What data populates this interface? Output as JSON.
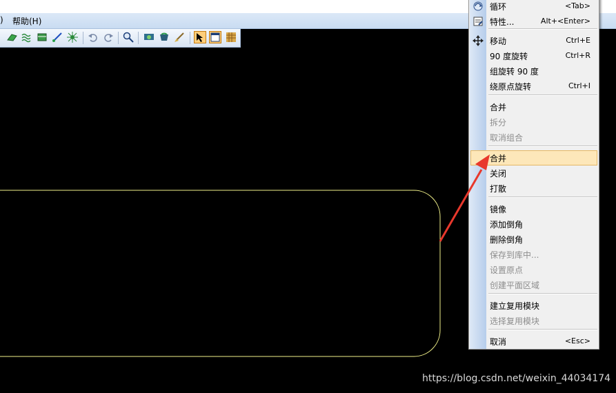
{
  "menubar": {
    "partial_label": ")",
    "help_label": "帮助(H)"
  },
  "context_menu": {
    "items": [
      {
        "label": "循环",
        "shortcut": "<Tab>",
        "icon": "cycle-icon",
        "disabled": false
      },
      {
        "label": "特性...",
        "shortcut": "Alt+<Enter>",
        "icon": "properties-icon",
        "disabled": false
      },
      {
        "label": "移动",
        "shortcut": "Ctrl+E",
        "icon": "move-icon",
        "disabled": false
      },
      {
        "label": "90 度旋转",
        "shortcut": "Ctrl+R",
        "disabled": false
      },
      {
        "label": "组旋转 90 度",
        "shortcut": "",
        "disabled": false
      },
      {
        "label": "绕原点旋转",
        "shortcut": "Ctrl+I",
        "disabled": false
      },
      {
        "label": "合并",
        "shortcut": "",
        "disabled": false
      },
      {
        "label": "拆分",
        "shortcut": "",
        "disabled": true
      },
      {
        "label": "取消组合",
        "shortcut": "",
        "disabled": true
      },
      {
        "label": "合并",
        "shortcut": "",
        "disabled": false,
        "highlighted": true
      },
      {
        "label": "关闭",
        "shortcut": "",
        "disabled": false
      },
      {
        "label": "打散",
        "shortcut": "",
        "disabled": false
      },
      {
        "label": "镜像",
        "shortcut": "",
        "disabled": false
      },
      {
        "label": "添加倒角",
        "shortcut": "",
        "disabled": false
      },
      {
        "label": "删除倒角",
        "shortcut": "",
        "disabled": false
      },
      {
        "label": "保存到库中...",
        "shortcut": "",
        "disabled": true
      },
      {
        "label": "设置原点",
        "shortcut": "",
        "disabled": true
      },
      {
        "label": "创建平面区域",
        "shortcut": "",
        "disabled": true
      },
      {
        "label": "建立复用模块",
        "shortcut": "",
        "disabled": false
      },
      {
        "label": "选择复用模块",
        "shortcut": "",
        "disabled": true
      },
      {
        "label": "取消",
        "shortcut": "<Esc>",
        "disabled": false
      }
    ]
  },
  "watermark": "https://blog.csdn.net/weixin_44034174",
  "colors": {
    "canvas": "#000000",
    "outline": "#f2f28a",
    "highlight": "#fde7b9",
    "arrow": "#e8382c"
  }
}
